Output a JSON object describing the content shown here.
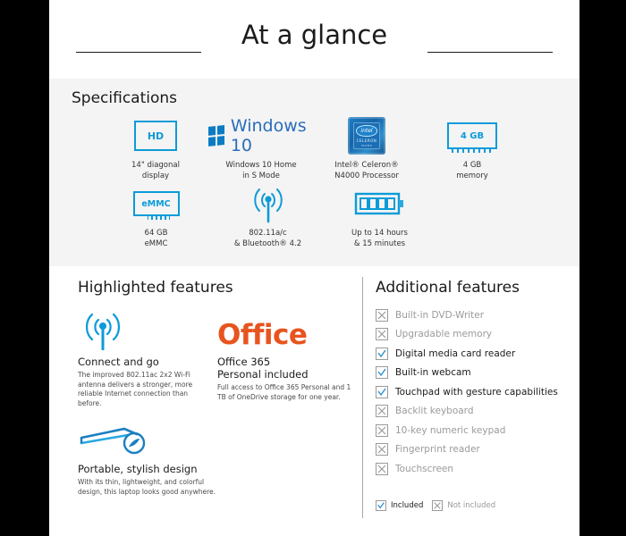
{
  "header": {
    "title": "At a glance"
  },
  "specifications": {
    "title": "Specifications",
    "items": [
      {
        "icon": "hd-display-icon",
        "icon_text": "HD",
        "label_line1": "14\" diagonal",
        "label_line2": "display"
      },
      {
        "icon": "windows-10-logo",
        "icon_text": "Windows 10",
        "label_line1": "Windows 10 Home",
        "label_line2": "in S Mode"
      },
      {
        "icon": "intel-celeron-badge-icon",
        "icon_text": "intel CELERON",
        "label_line1": "Intel® Celeron®",
        "label_line2": "N4000 Processor"
      },
      {
        "icon": "memory-module-icon",
        "icon_text": "4 GB",
        "label_line1": "4 GB",
        "label_line2": "memory"
      },
      {
        "icon": "emmc-storage-icon",
        "icon_text": "eMMC",
        "label_line1": "64 GB",
        "label_line2": "eMMC"
      },
      {
        "icon": "wireless-signal-icon",
        "icon_text": "",
        "label_line1": "802.11a/c",
        "label_line2": "& Bluetooth® 4.2"
      },
      {
        "icon": "battery-icon",
        "icon_text": "",
        "label_line1": "Up to 14 hours",
        "label_line2": "& 15 minutes"
      }
    ]
  },
  "highlighted": {
    "title": "Highlighted features",
    "features": [
      {
        "icon": "wireless-signal-icon",
        "heading": "Connect and go",
        "body": "The improved 802.11ac 2x2 Wi-Fi antenna delivers a stronger, more reliable Internet connection than before."
      },
      {
        "icon": "office-logo",
        "logo_text": "Office",
        "heading_line1": "Office 365",
        "heading_line2": "Personal included",
        "body": "Full access to Office 365 Personal and 1 TB of OneDrive storage for one year."
      },
      {
        "icon": "laptop-design-icon",
        "heading": "Portable, stylish design",
        "body": "With its thin, lightweight, and colorful design, this laptop looks good anywhere."
      }
    ]
  },
  "additional": {
    "title": "Additional features",
    "items": [
      {
        "label": "Built-in DVD-Writer",
        "included": false
      },
      {
        "label": "Upgradable memory",
        "included": false
      },
      {
        "label": "Digital media card reader",
        "included": true
      },
      {
        "label": "Built-in webcam",
        "included": true
      },
      {
        "label": "Touchpad with gesture capabilities",
        "included": true
      },
      {
        "label": "Backlit keyboard",
        "included": false
      },
      {
        "label": "10-key numeric keypad",
        "included": false
      },
      {
        "label": "Fingerprint reader",
        "included": false
      },
      {
        "label": "Touchscreen",
        "included": false
      }
    ],
    "legend": {
      "included_label": "Included",
      "not_included_label": "Not included"
    }
  },
  "colors": {
    "accent_blue": "#0b9bd8",
    "windows_blue": "#2a6ebb",
    "office_orange": "#e8541e",
    "panel_gray": "#f4f4f4",
    "text_dark": "#1b1b1b",
    "text_muted": "#9a9a9a"
  }
}
